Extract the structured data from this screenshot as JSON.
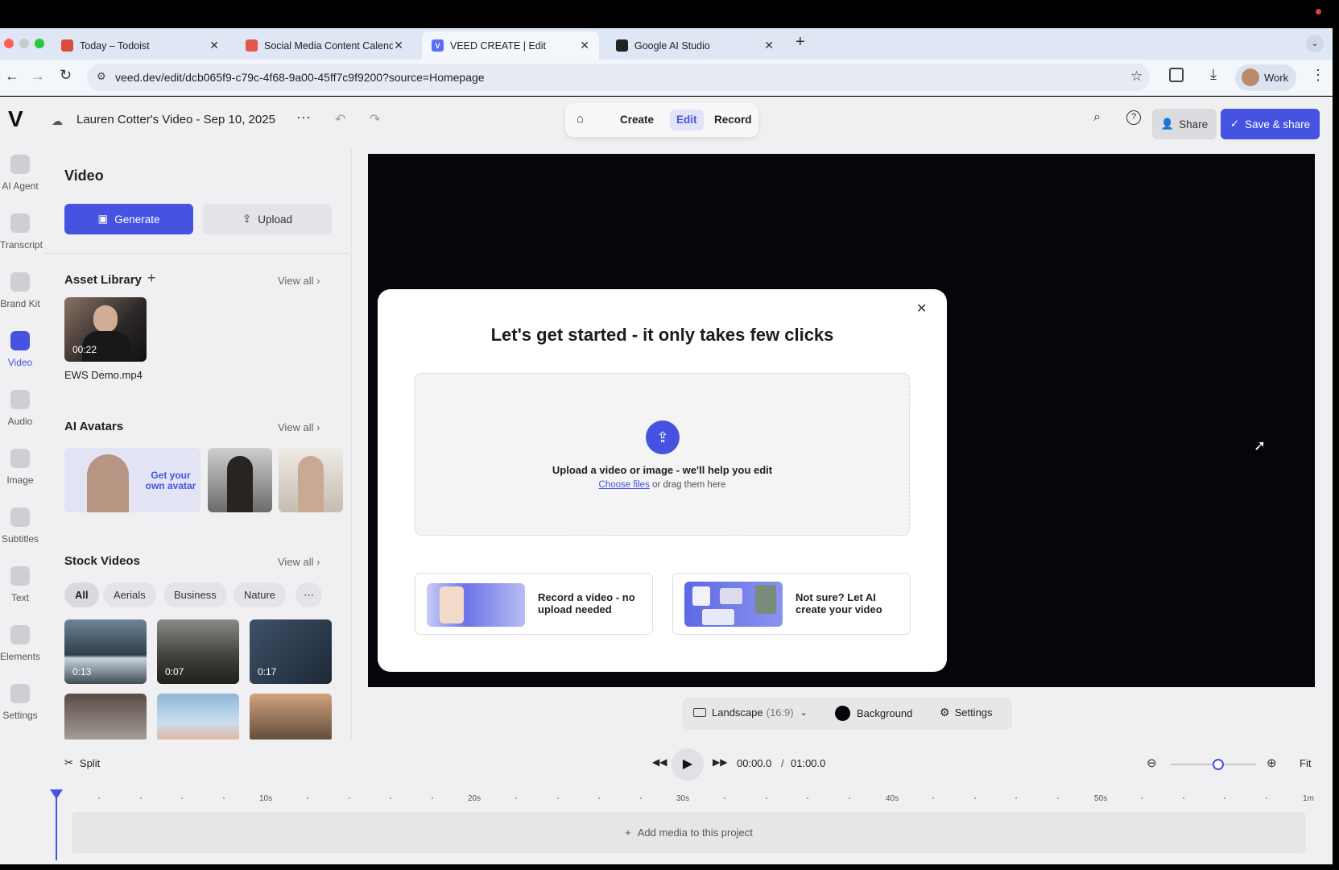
{
  "browser": {
    "tabs": [
      {
        "title": "Today – Todoist",
        "favicon_color": "#db4c3f"
      },
      {
        "title": "Social Media Content Calend...",
        "favicon_color": "#e05a4e"
      },
      {
        "title": "VEED CREATE | Edit",
        "favicon_color": "#5b6ef5"
      },
      {
        "title": "Google AI Studio",
        "favicon_color": "#222222"
      }
    ],
    "url": "veed.dev/edit/dcb065f9-c79c-4f68-9a00-45ff7c9f9200?source=Homepage",
    "profile_label": "Work"
  },
  "app": {
    "logo": "V",
    "project_title": "Lauren Cotter's Video - Sep 10, 2025",
    "modes": [
      "Create",
      "Edit",
      "Record"
    ],
    "active_mode": "Edit",
    "share_label": "Share",
    "save_share_label": "Save & share",
    "accent": "#4652e0"
  },
  "rail": [
    {
      "label": "AI Agent"
    },
    {
      "label": "Transcript"
    },
    {
      "label": "Brand Kit"
    },
    {
      "label": "Video"
    },
    {
      "label": "Audio"
    },
    {
      "label": "Image"
    },
    {
      "label": "Subtitles"
    },
    {
      "label": "Text"
    },
    {
      "label": "Elements"
    },
    {
      "label": "Settings"
    }
  ],
  "panel": {
    "title": "Video",
    "generate_label": "Generate",
    "upload_label": "Upload",
    "asset_library": {
      "title": "Asset Library",
      "view_all": "View all",
      "items": [
        {
          "duration": "00:22",
          "name": "EWS Demo.mp4"
        }
      ]
    },
    "ai_avatars": {
      "title": "AI Avatars",
      "view_all": "View all",
      "promo": "Get your own avatar"
    },
    "stock_videos": {
      "title": "Stock Videos",
      "view_all": "View all",
      "filters": [
        "All",
        "Aerials",
        "Business",
        "Nature"
      ],
      "items": [
        {
          "duration": "0:13"
        },
        {
          "duration": "0:07"
        },
        {
          "duration": "0:17"
        }
      ]
    }
  },
  "modal": {
    "title": "Let's get started - it only takes few clicks",
    "upload_text": "Upload a video or image - we'll help you edit",
    "choose_files": "Choose files",
    "drag_text": "or drag them here",
    "options": [
      {
        "label": "Record a video - no upload needed"
      },
      {
        "label": "Not sure? Let AI create your video"
      }
    ]
  },
  "canvas_bar": {
    "aspect_label": "Landscape",
    "aspect_ratio": "(16:9)",
    "background_label": "Background",
    "settings_label": "Settings"
  },
  "timeline": {
    "split_label": "Split",
    "current_time": "00:00.0",
    "separator": "/",
    "total_time": "01:00.0",
    "fit_label": "Fit",
    "ticks": [
      "10s",
      "20s",
      "30s",
      "40s",
      "50s",
      "1m"
    ],
    "add_media": "Add media to this project"
  }
}
